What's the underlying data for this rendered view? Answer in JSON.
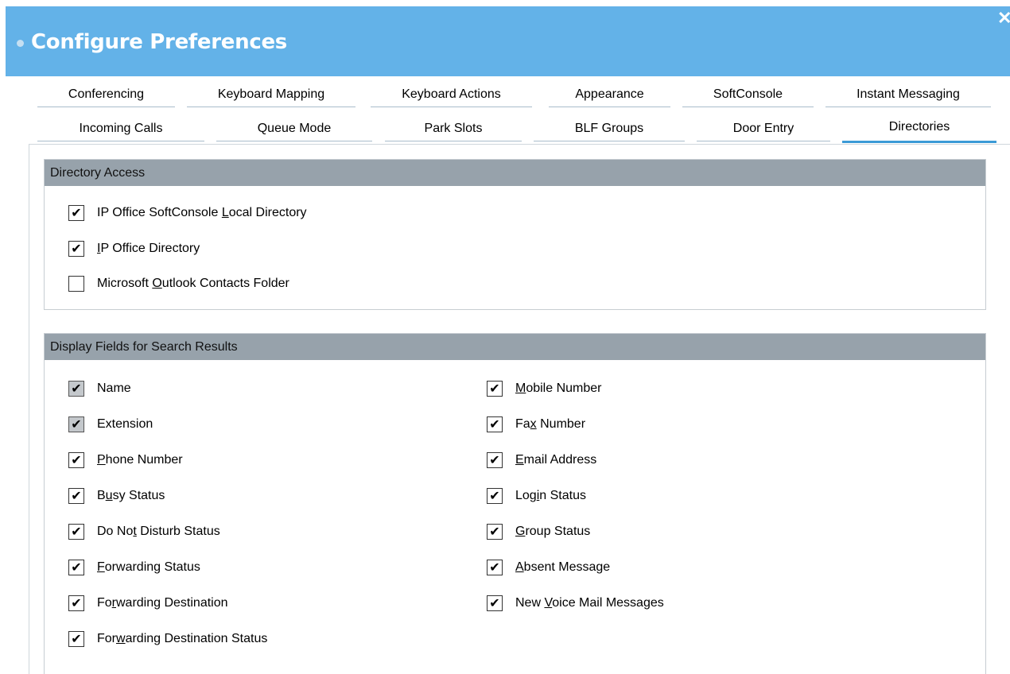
{
  "window": {
    "title": "Configure Preferences",
    "close_glyph": "✕",
    "colors": {
      "titlebar": "#63b2e8",
      "group_header": "#97a2ab",
      "active_tab": "#3b9ad6"
    }
  },
  "tabs": {
    "row1": [
      "Conferencing",
      "Keyboard Mapping",
      "Keyboard Actions",
      "Appearance",
      "SoftConsole",
      "Instant Messaging"
    ],
    "row2": [
      "Incoming Calls",
      "Queue Mode",
      "Park Slots",
      "BLF Groups",
      "Door Entry",
      "Directories"
    ],
    "active": "Directories"
  },
  "directory_access": {
    "header": "Directory Access",
    "items": [
      {
        "label": "IP Office SoftConsole Local Directory",
        "checked": true,
        "disabled": false
      },
      {
        "label": "IP Office Directory",
        "checked": true,
        "disabled": false
      },
      {
        "label": "Microsoft Outlook Contacts Folder",
        "checked": false,
        "disabled": false
      }
    ]
  },
  "display_fields": {
    "header": "Display Fields for Search Results",
    "left": [
      {
        "label": "Name",
        "checked": true,
        "disabled": true
      },
      {
        "label": "Extension",
        "checked": true,
        "disabled": true
      },
      {
        "label": "Phone Number",
        "checked": true,
        "disabled": false
      },
      {
        "label": "Busy Status",
        "checked": true,
        "disabled": false
      },
      {
        "label": "Do Not Disturb Status",
        "checked": true,
        "disabled": false
      },
      {
        "label": "Forwarding Status",
        "checked": true,
        "disabled": false
      },
      {
        "label": "Forwarding Destination",
        "checked": true,
        "disabled": false
      },
      {
        "label": "Forwarding Destination Status",
        "checked": true,
        "disabled": false
      }
    ],
    "right": [
      {
        "label": "Mobile Number",
        "checked": true,
        "disabled": false
      },
      {
        "label": "Fax Number",
        "checked": true,
        "disabled": false
      },
      {
        "label": "Email Address",
        "checked": true,
        "disabled": false
      },
      {
        "label": "Login Status",
        "checked": true,
        "disabled": false
      },
      {
        "label": "Group Status",
        "checked": true,
        "disabled": false
      },
      {
        "label": "Absent Message",
        "checked": true,
        "disabled": false
      },
      {
        "label": "New Voice Mail Messages",
        "checked": true,
        "disabled": false
      }
    ]
  }
}
